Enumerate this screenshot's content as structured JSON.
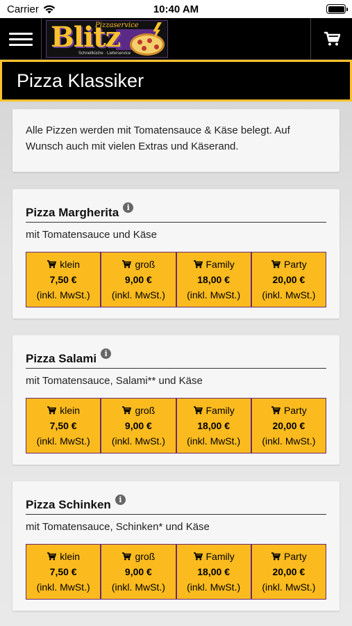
{
  "status": {
    "carrier": "Carrier",
    "time": "10:40 AM"
  },
  "header": {
    "brand_small": "Pizzaservice",
    "brand_main": "Blitz",
    "brand_sub": "Schnellküche · Lieferservice"
  },
  "page": {
    "title": "Pizza Klassiker"
  },
  "intro": "Alle Pizzen werden mit Tomatensauce & Käse belegt. Auf Wunsch auch mit vielen Extras und Käserand.",
  "products": [
    {
      "name": "Pizza Margherita",
      "desc": "mit Tomatensauce und Käse",
      "prices": [
        {
          "size": "klein",
          "price": "7,50 €",
          "note": "(inkl. MwSt.)"
        },
        {
          "size": "groß",
          "price": "9,00 €",
          "note": "(inkl. MwSt.)"
        },
        {
          "size": "Family",
          "price": "18,00 €",
          "note": "(inkl. MwSt.)"
        },
        {
          "size": "Party",
          "price": "20,00 €",
          "note": "(inkl. MwSt.)"
        }
      ]
    },
    {
      "name": "Pizza Salami",
      "desc": "mit Tomatensauce, Salami** und Käse",
      "prices": [
        {
          "size": "klein",
          "price": "7,50 €",
          "note": "(inkl. MwSt.)"
        },
        {
          "size": "groß",
          "price": "9,00 €",
          "note": "(inkl. MwSt.)"
        },
        {
          "size": "Family",
          "price": "18,00 €",
          "note": "(inkl. MwSt.)"
        },
        {
          "size": "Party",
          "price": "20,00 €",
          "note": "(inkl. MwSt.)"
        }
      ]
    },
    {
      "name": "Pizza Schinken",
      "desc": "mit Tomatensauce, Schinken* und Käse",
      "prices": [
        {
          "size": "klein",
          "price": "7,50 €",
          "note": "(inkl. MwSt.)"
        },
        {
          "size": "groß",
          "price": "9,00 €",
          "note": "(inkl. MwSt.)"
        },
        {
          "size": "Family",
          "price": "18,00 €",
          "note": "(inkl. MwSt.)"
        },
        {
          "size": "Party",
          "price": "20,00 €",
          "note": "(inkl. MwSt.)"
        }
      ]
    }
  ],
  "colors": {
    "accent": "#fbbb1e",
    "header": "#000000",
    "border": "#6a2a70"
  }
}
